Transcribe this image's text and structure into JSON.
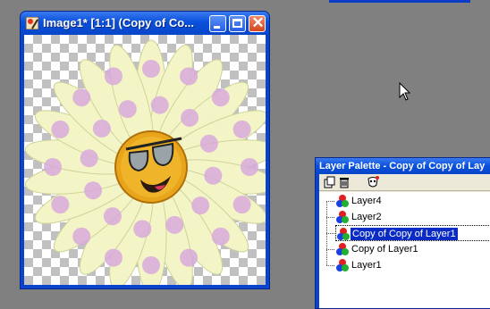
{
  "image_window": {
    "title": "Image1* [1:1] (Copy of Co...",
    "buttons": {
      "minimize": "minimize",
      "maximize": "maximize",
      "close": "close"
    },
    "close_symbol": "✕"
  },
  "layer_palette": {
    "title": "Layer Palette - Copy of Copy of Lay",
    "tools": [
      "new-layer-icon",
      "delete-layer-icon",
      "mask-icon"
    ],
    "layers": [
      {
        "label": "Layer4"
      },
      {
        "label": "Layer2"
      },
      {
        "label": "Copy of Copy of Layer1"
      },
      {
        "label": "Copy of Layer1"
      },
      {
        "label": "Layer1"
      }
    ],
    "selected_index": 2
  },
  "colors": {
    "desktop": "#808080",
    "title_blue": "#0a50dc",
    "selection": "#0a2cc4",
    "petal": "#f3f5c6",
    "spot": "#d7a9dc",
    "face": "#e8a41a"
  }
}
